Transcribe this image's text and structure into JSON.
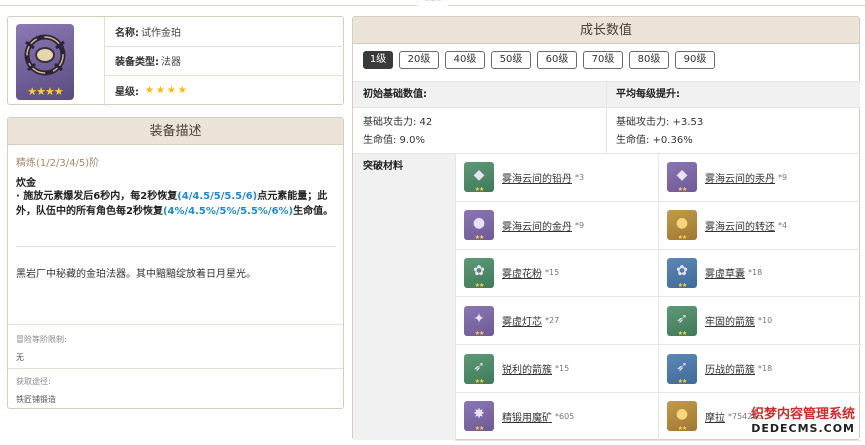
{
  "item": {
    "name_label": "名称:",
    "name": "试作金珀",
    "type_label": "装备类型:",
    "type": "法器",
    "rarity_label": "星级:",
    "rarity_stars": 4,
    "icon": "catalyst-ring-icon"
  },
  "description": {
    "title": "装备描述",
    "refine": "精炼(1/2/3/4/5)阶",
    "skill_name": "炊金",
    "skill_part1": "· 施放元素爆发后6秒内，每2秒恢复",
    "skill_hl1": "(4/4.5/5/5.5/6)",
    "skill_part2": "点元素能量；此外，队伍中的所有角色每2秒恢复",
    "skill_hl2": "(4%/4.5%/5%/5.5%/6%)",
    "skill_part3": "生命值。",
    "lore": "黑岩厂中秘藏的金珀法器。其中黯黯绽放着日月星光。",
    "limit_label": "冒险等阶限制:",
    "limit_value": "无",
    "source_label": "获取途径:",
    "source_value": "铁匠铺锻造"
  },
  "growth": {
    "title": "成长数值",
    "levels": [
      "1级",
      "20级",
      "40级",
      "50级",
      "60级",
      "70级",
      "80级",
      "90级"
    ],
    "active_level": "1级",
    "base_header": "初始基础数值:",
    "avg_header": "平均每级提升:",
    "base_atk": "基础攻击力: 42",
    "base_hp": "生命值: 9.0%",
    "avg_atk": "基础攻击力: +3.53",
    "avg_hp": "生命值: +0.36%",
    "materials_label": "突破材料",
    "materials": [
      {
        "name": "雾海云间的铅丹",
        "count": "*3",
        "quality": "q2",
        "icon": "lead-ore-icon"
      },
      {
        "name": "雾海云间的汞丹",
        "count": "*9",
        "quality": "q4",
        "icon": "mercury-ore-icon"
      },
      {
        "name": "雾海云间的金丹",
        "count": "*9",
        "quality": "q4",
        "icon": "gold-pill-icon"
      },
      {
        "name": "雾海云间的转还",
        "count": "*4",
        "quality": "q5",
        "icon": "golden-pill-icon"
      },
      {
        "name": "雾虚花粉",
        "count": "*15",
        "quality": "q2",
        "icon": "pollen-icon"
      },
      {
        "name": "雾虚草囊",
        "count": "*18",
        "quality": "q3",
        "icon": "grass-pouch-icon"
      },
      {
        "name": "雾虚灯芯",
        "count": "*27",
        "quality": "q4",
        "icon": "lamp-wick-icon"
      },
      {
        "name": "牢固的箭簇",
        "count": "*10",
        "quality": "q2",
        "icon": "arrowhead-icon"
      },
      {
        "name": "锐利的箭簇",
        "count": "*15",
        "quality": "q2",
        "icon": "sharp-arrowhead-icon"
      },
      {
        "name": "历战的箭簇",
        "count": "*18",
        "quality": "q3",
        "icon": "weathered-arrowhead-icon"
      },
      {
        "name": "精锻用魔矿",
        "count": "*605",
        "quality": "q4",
        "icon": "mystic-ore-icon"
      },
      {
        "name": "摩拉",
        "count": "*754265",
        "quality": "q5",
        "icon": "mora-coin-icon"
      }
    ]
  },
  "watermark": {
    "line1": "织梦内容管理系统",
    "line2": "DEDECMS.COM"
  }
}
